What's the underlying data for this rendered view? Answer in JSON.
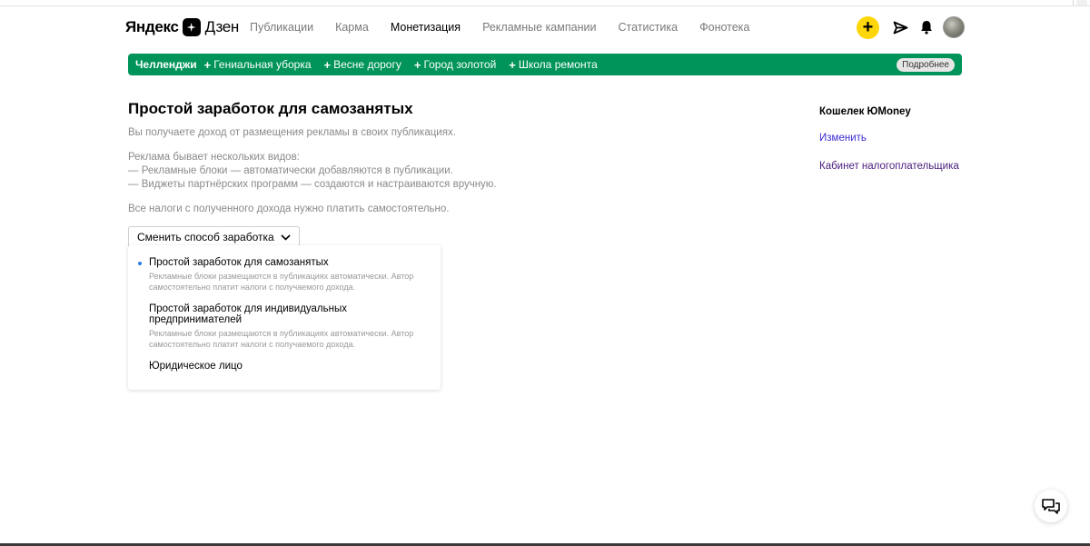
{
  "header": {
    "logo_word_1": "Яндекс",
    "logo_word_2": "Дзен",
    "nav": [
      {
        "label": "Публикации"
      },
      {
        "label": "Карма"
      },
      {
        "label": "Монетизация"
      },
      {
        "label": "Рекламные кампании"
      },
      {
        "label": "Статистика"
      },
      {
        "label": "Фонотека"
      }
    ],
    "active_nav": "Монетизация",
    "add_label": "+",
    "icons": [
      "plus-icon",
      "send-icon",
      "bell-icon",
      "avatar"
    ],
    "accent_color": "#ffd60a"
  },
  "banner": {
    "title": "Челленджи",
    "items": [
      {
        "label": "Гениальная уборка"
      },
      {
        "label": "Весне дорогу"
      },
      {
        "label": "Город золотой"
      },
      {
        "label": "Школа ремонта"
      }
    ],
    "more_label": "Подробнее",
    "color": "#00945a"
  },
  "main": {
    "title": "Простой заработок для самозанятых",
    "intro": "Вы получаете доход от размещения рекламы в своих публикациях.",
    "types_heading": "Реклама бывает нескольких видов:",
    "type_1": "— Рекламные блоки — автоматически добавляются в публикации.",
    "type_2": "— Виджеты партнёрских программ — создаются и настраиваются вручную.",
    "taxes": "Все налоги с полученного дохода нужно платить самостоятельно.",
    "switch_label": "Сменить способ заработка"
  },
  "dropdown": {
    "options": [
      {
        "title": "Простой заработок для самозанятых",
        "desc": "Рекламные блоки размещаются в публикациях автоматически. Автор самостоятельно платит налоги с получаемого дохода.",
        "selected": true
      },
      {
        "title": "Простой заработок для индивидуальных предпринимателей",
        "desc": "Рекламные блоки размещаются в публикациях автоматически. Автор самостоятельно платит налоги с получаемого дохода.",
        "selected": false
      },
      {
        "title": "Юридическое лицо",
        "desc": "",
        "selected": false
      }
    ],
    "selected_color": "#2c7ce5"
  },
  "sidebar": {
    "wallet": "Кошелек ЮMoney",
    "change_link": "Изменить",
    "cabinet_link": "Кабинет налогоплательщика"
  },
  "chat": {
    "icon": "chat-icon"
  }
}
